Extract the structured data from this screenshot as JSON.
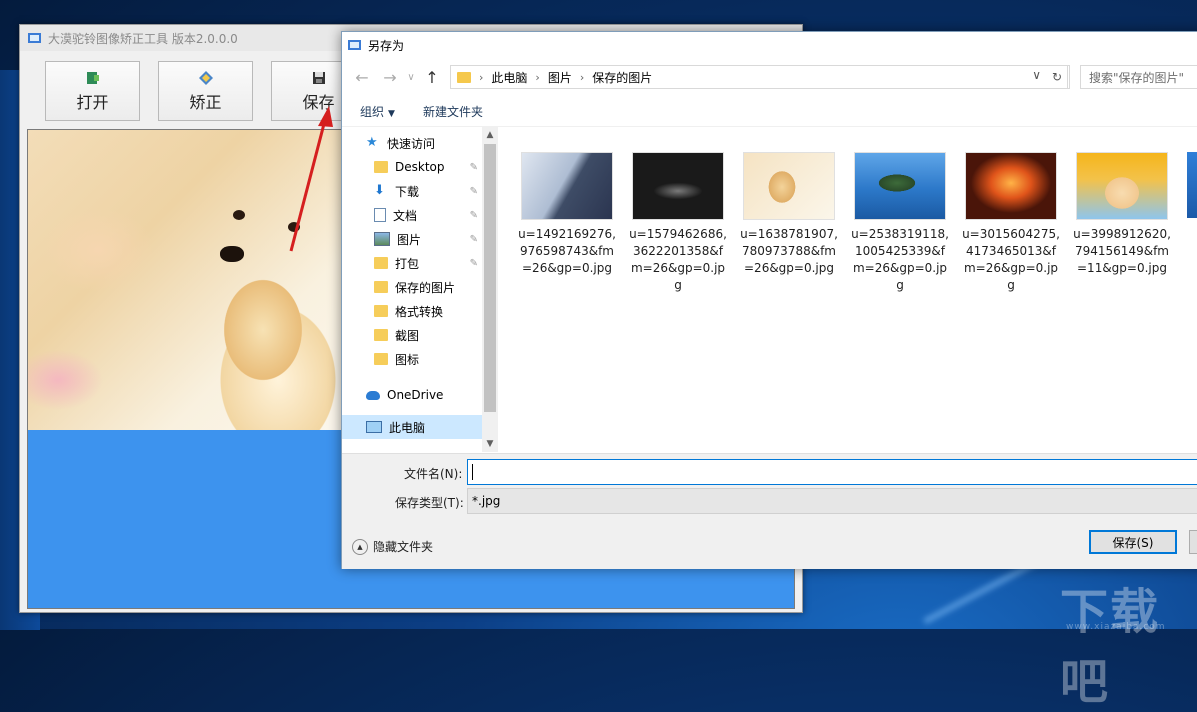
{
  "app": {
    "title": "大漠驼铃图像矫正工具 版本2.0.0.0",
    "toolbar": [
      {
        "label": "打开",
        "icon": "open-icon"
      },
      {
        "label": "矫正",
        "icon": "correct-icon"
      },
      {
        "label": "保存",
        "icon": "floppy-disk-icon"
      }
    ]
  },
  "dialog": {
    "title": "另存为",
    "breadcrumb": [
      "此电脑",
      "图片",
      "保存的图片"
    ],
    "search_placeholder": "搜索\"保存的图片\"",
    "commands": {
      "organize": "组织",
      "new_folder": "新建文件夹"
    },
    "nav": {
      "quick_access": "快速访问",
      "items": [
        {
          "label": "Desktop",
          "icon": "folder-icon",
          "pinned": true
        },
        {
          "label": "下载",
          "icon": "download-icon",
          "pinned": true
        },
        {
          "label": "文档",
          "icon": "document-icon",
          "pinned": true
        },
        {
          "label": "图片",
          "icon": "pictures-icon",
          "pinned": true
        },
        {
          "label": "打包",
          "icon": "folder-icon",
          "pinned": true
        },
        {
          "label": "保存的图片",
          "icon": "folder-icon",
          "pinned": false
        },
        {
          "label": "格式转换",
          "icon": "folder-icon",
          "pinned": false
        },
        {
          "label": "截图",
          "icon": "folder-icon",
          "pinned": false
        },
        {
          "label": "图标",
          "icon": "folder-icon",
          "pinned": false
        }
      ],
      "onedrive": "OneDrive",
      "this_pc": "此电脑"
    },
    "files": [
      {
        "name": "u=1492169276,976598743&fm=26&gp=0.jpg",
        "colors": [
          "#cfd8e6",
          "#4a5b78"
        ]
      },
      {
        "name": "u=1579462686,3622201358&fm=26&gp=0.jpg",
        "colors": [
          "#0e0e0e",
          "#6d6d6d"
        ]
      },
      {
        "name": "u=1638781907,780973788&fm=26&gp=0.jpg",
        "colors": [
          "#f4e2bd",
          "#e1b475"
        ]
      },
      {
        "name": "u=2538319118,1005425339&fm=26&gp=0.jpg",
        "colors": [
          "#2a7fd6",
          "#2f6a3a"
        ]
      },
      {
        "name": "u=3015604275,4173465013&fm=26&gp=0.jpg",
        "colors": [
          "#e05a12",
          "#5c1b0c"
        ]
      },
      {
        "name": "u=3998912620,794156149&fm=11&gp=0.jpg",
        "colors": [
          "#f2b21d",
          "#f7d8a6"
        ]
      }
    ],
    "filename_label": "文件名(N):",
    "filename_value": "",
    "filetype_label": "保存类型(T):",
    "filetype_value": "*.jpg",
    "hide_folders": "隐藏文件夹",
    "save_button": "保存(S)"
  },
  "watermark": {
    "text": "下载吧",
    "sub": "www.xiazaiba.com"
  }
}
